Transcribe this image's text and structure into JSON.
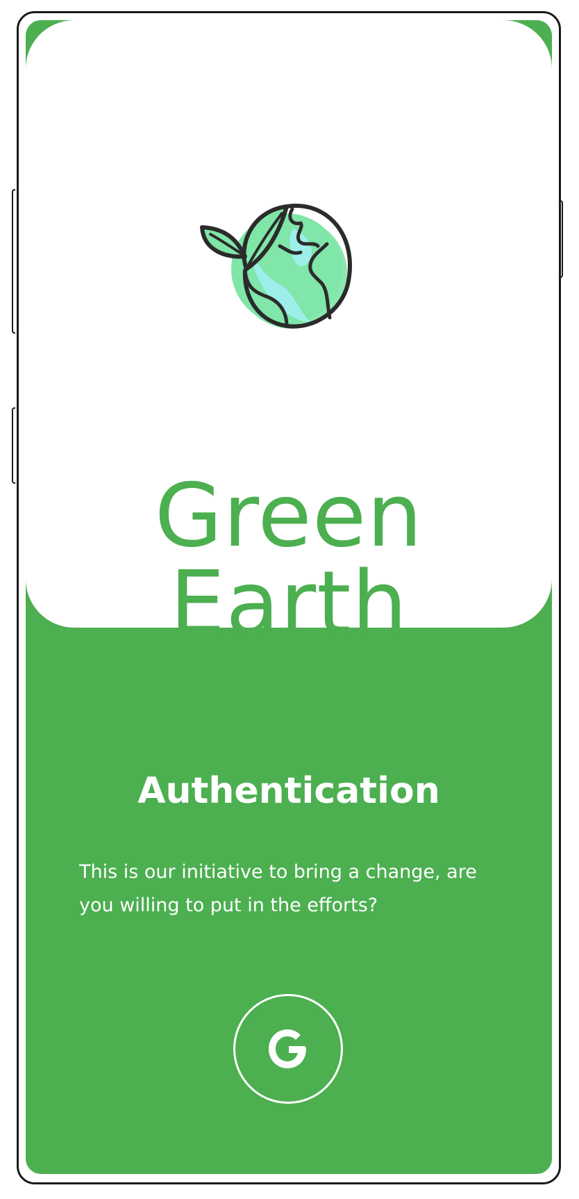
{
  "app": {
    "title": "Green Earth",
    "logo_icon": "earth-leaf-icon"
  },
  "auth": {
    "title": "Authentication",
    "description": "This is our initiative to bring a change, are you willing to put in the efforts?",
    "google_button_icon": "google-icon"
  },
  "colors": {
    "brand_green": "#4caf50",
    "earth_land": "#80e6a8",
    "earth_water": "#9eeeea",
    "outline": "#2b2b2b",
    "background": "#ffffff"
  }
}
